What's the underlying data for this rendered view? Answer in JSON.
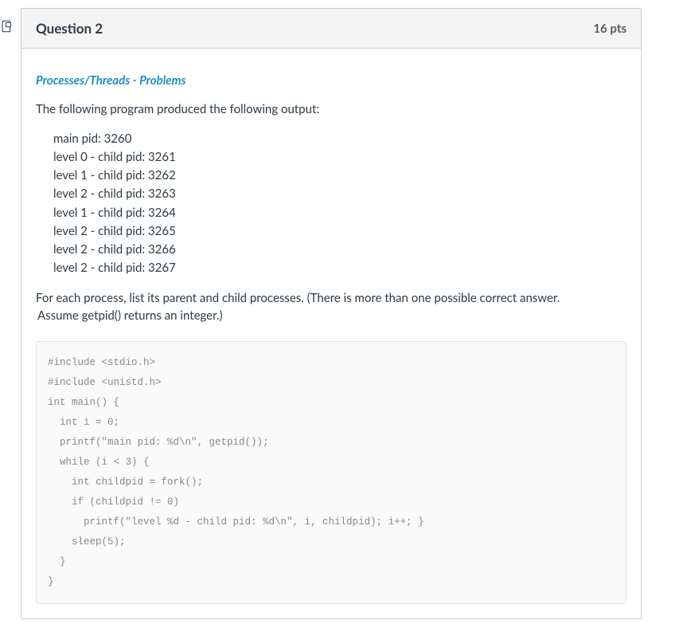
{
  "header": {
    "title": "Question 2",
    "points": "16 pts"
  },
  "section_heading": "Processes/Threads - Problems",
  "intro": "The following program produced the following output:",
  "output_lines": [
    "main pid: 3260",
    "level 0 - child pid: 3261",
    "level 1 - child pid: 3262",
    "level 2 - child pid: 3263",
    "level 1 - child pid: 3264",
    "level 2 - child pid: 3265",
    "level 2 - child pid: 3266",
    "level 2 - child pid: 3267"
  ],
  "explain_line1": "For each process, list its parent and child processes. (There is more than one possible correct answer.",
  "explain_line2": "Assume getpid() returns an integer.)",
  "code": "#include <stdio.h>\n#include <unistd.h>\nint main() {\n  int i = 0;\n  printf(\"main pid: %d\\n\", getpid());\n  while (i < 3) {\n    int childpid = fork();\n    if (childpid != 0)\n      printf(\"level %d - child pid: %d\\n\", i, childpid); i++; }\n    sleep(5);\n  }\n}"
}
